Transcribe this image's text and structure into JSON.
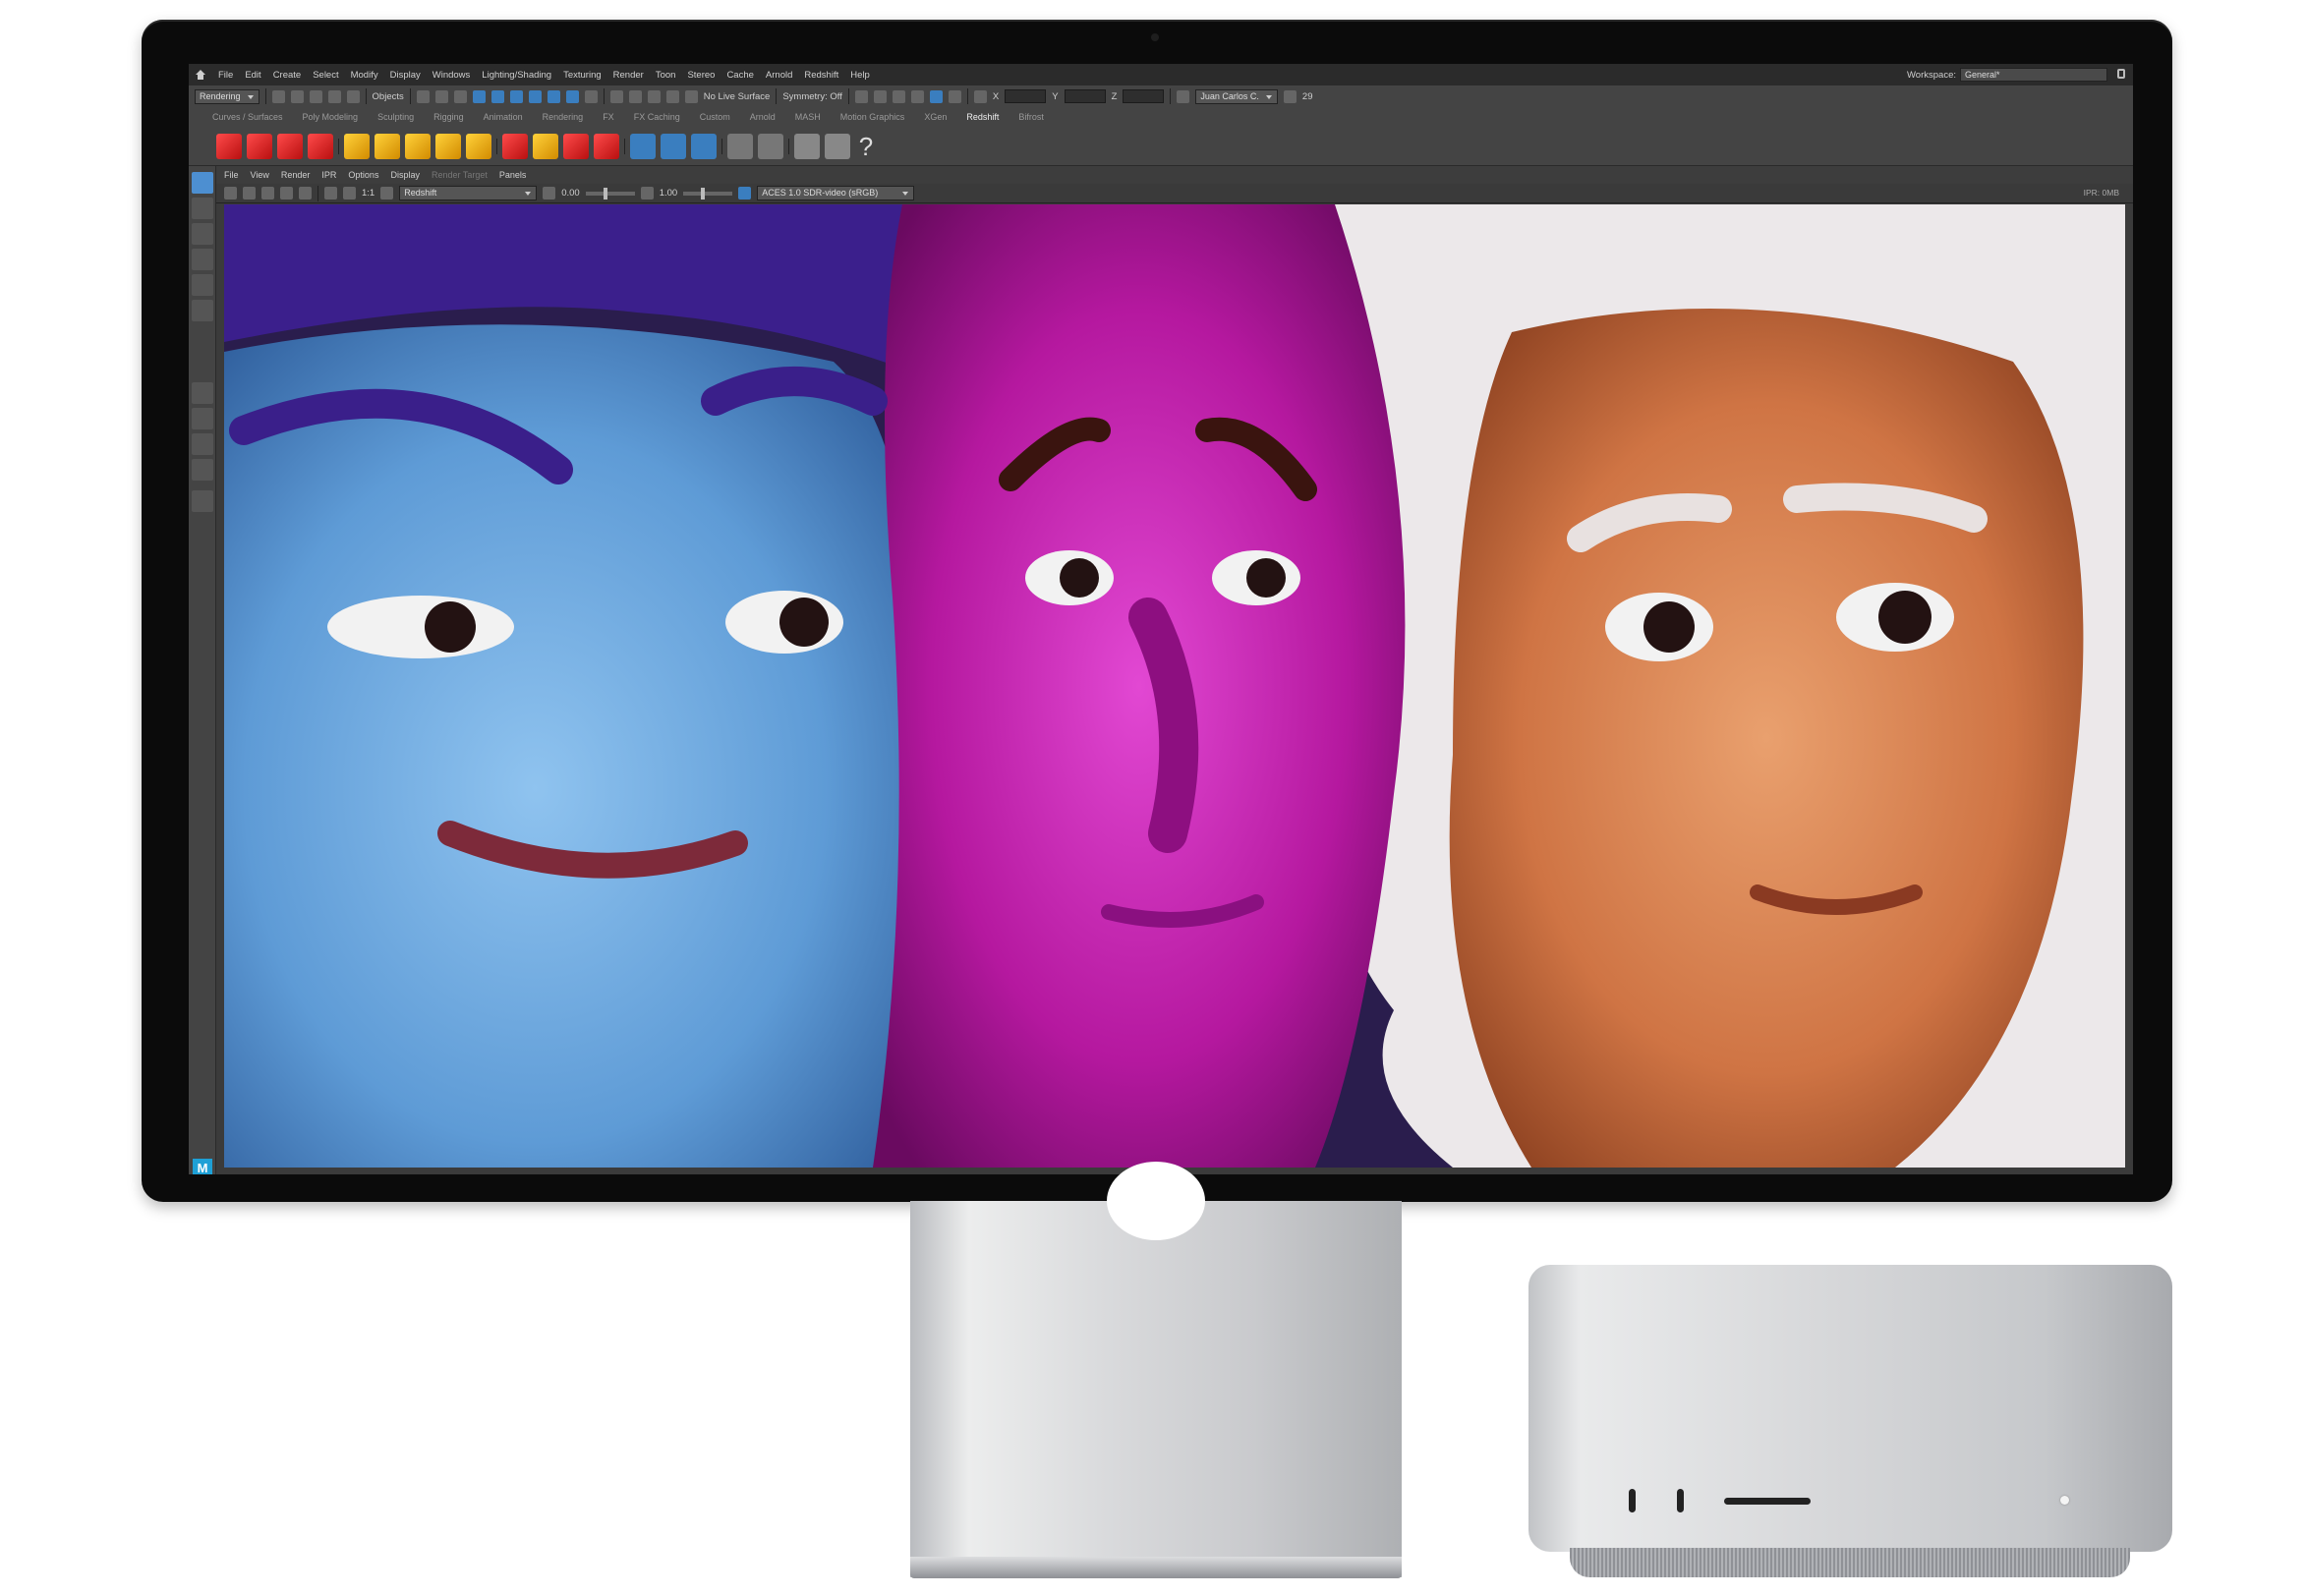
{
  "menu": [
    "File",
    "Edit",
    "Create",
    "Select",
    "Modify",
    "Display",
    "Windows",
    "Lighting/Shading",
    "Texturing",
    "Render",
    "Toon",
    "Stereo",
    "Cache",
    "Arnold",
    "Redshift",
    "Help"
  ],
  "workspace": {
    "label": "Workspace:",
    "value": "General*"
  },
  "status_line": {
    "mode": "Rendering",
    "objects": "Objects",
    "live_surface": "No Live Surface",
    "symmetry": "Symmetry: Off",
    "user": "Juan Carlos C.",
    "count": "29",
    "axis_x": "X",
    "axis_y": "Y",
    "axis_z": "Z"
  },
  "shelf_tabs": [
    "Curves / Surfaces",
    "Poly Modeling",
    "Sculpting",
    "Rigging",
    "Animation",
    "Rendering",
    "FX",
    "FX Caching",
    "Custom",
    "Arnold",
    "MASH",
    "Motion Graphics",
    "XGen",
    "Redshift",
    "Bifrost"
  ],
  "active_shelf": "Redshift",
  "panel_menu": [
    "File",
    "View",
    "Render",
    "IPR",
    "Options",
    "Display",
    "Render Target",
    "Panels"
  ],
  "panel_tools": {
    "ratio": "1:1",
    "renderer": "Redshift",
    "exposure": "0.00",
    "gamma": "1.00",
    "colorspace": "ACES 1.0 SDR-video (sRGB)",
    "ipr_status": "IPR: 0MB"
  },
  "maya_logo": "M",
  "colors": {
    "maya_bg": "#444444",
    "viewport_purple": "#2a1d4d",
    "face_blue": "#6aa8de",
    "face_magenta": "#c21cb4",
    "face_orange": "#d9824f",
    "hair_white": "#ece8ea",
    "selected_tool": "#4d8fd1"
  }
}
